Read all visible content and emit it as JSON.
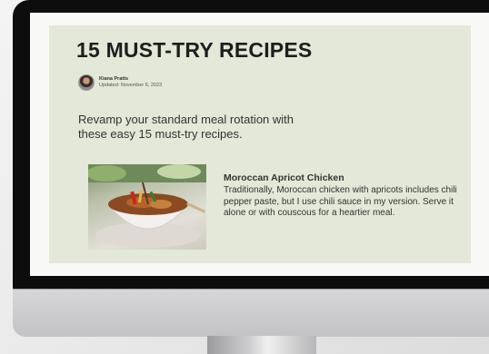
{
  "article": {
    "title": "15 MUST-TRY RECIPES",
    "author_name": "Kiana Pratts",
    "updated": "Updated: November 6, 2023",
    "intro": "Revamp your standard meal rotation with these easy 15 must-try recipes."
  },
  "recipe": {
    "title": "Moroccan Apricot Chicken",
    "description": "Traditionally, Moroccan chicken with apricots includes chili pepper paste, but I use chili sauce in my version. Serve it alone or with couscous for a heartier meal."
  }
}
